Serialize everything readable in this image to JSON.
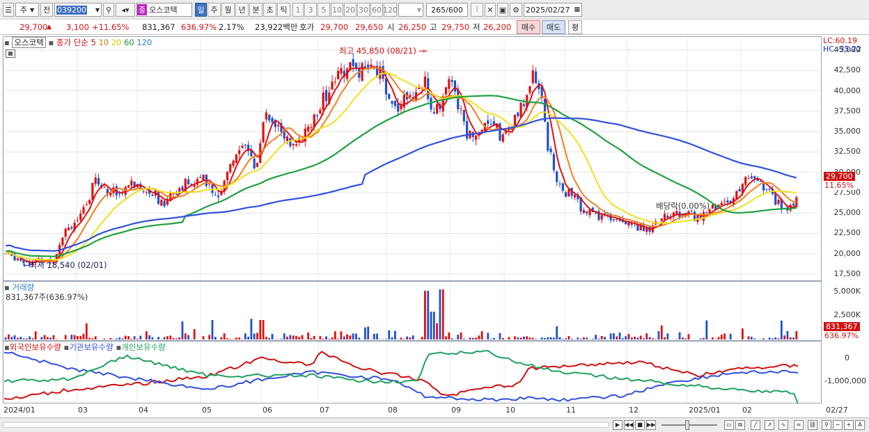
{
  "toolbar": {
    "period_select": "주",
    "prev_label": "전",
    "code": "039200",
    "stock_tag": "종",
    "stock_name": "오스코텍",
    "periods": [
      "일",
      "주",
      "월",
      "년",
      "분",
      "초",
      "틱"
    ],
    "intervals": [
      "1",
      "3",
      "5",
      "10",
      "20",
      "30",
      "60",
      "120"
    ],
    "count": "265",
    "count_total": "/600",
    "date": "2025/02/27"
  },
  "info": {
    "price": "29,700",
    "change": "3,100",
    "change_pct": "+11.65%",
    "volume": "831,367",
    "volume_ratio": "636.97%",
    "turnover_pct": "2.17%",
    "trade_amount": "23,922백만",
    "quote_label": "호가",
    "ask": "29,700",
    "bid": "29,650",
    "open_label": "시",
    "open": "26,250",
    "high_label": "고",
    "high": "29,750",
    "low_label": "저",
    "low": "26,200",
    "buy_label": "매수",
    "sell_label": "매도",
    "avg_label": "평"
  },
  "price_pane": {
    "name_box": "오스코텍",
    "legend_close": "종가 단순",
    "ma_periods": [
      "5",
      "10",
      "20",
      "60",
      "120"
    ],
    "ma_colors": [
      "#e01010",
      "#f08020",
      "#f0e020",
      "#20a040",
      "#3050e0"
    ],
    "lc": "LC:60.19",
    "hc": "HC:-35.22",
    "high_annot": "최고 45,850 (08/21)",
    "low_annot": "최저 18,540 (02/01)",
    "div_annot": "배당락(0.00%)",
    "price_tag": "29,700",
    "pct_tag": "11.65%",
    "yticks": [
      "45,000",
      "42,500",
      "40,000",
      "37,500",
      "35,000",
      "32,500",
      "30,000",
      "27,500",
      "25,000",
      "22,500",
      "20,000",
      "17,500"
    ]
  },
  "volume_pane": {
    "title": "거래량",
    "value": "831,367주(636.97%)",
    "yticks": [
      "5,000K",
      "2,500K"
    ],
    "tag": "831,367",
    "tag_pct": "636.97%"
  },
  "holder_pane": {
    "legend": [
      "외국인보유수량",
      "기관보유수량",
      "개인보유수량"
    ],
    "colors": [
      "#d01010",
      "#3050e0",
      "#20a060"
    ],
    "yticks": [
      "0",
      "-1,000,000"
    ]
  },
  "xaxis": [
    "2024/01",
    "03",
    "04",
    "05",
    "06",
    "07",
    "08",
    "09",
    "10",
    "11",
    "12",
    "2025/01",
    "02"
  ],
  "xaxis_end": "02/27",
  "chart_data": {
    "type": "candlestick",
    "x": [
      "2024/01",
      "03",
      "04",
      "05",
      "06",
      "07",
      "08",
      "09",
      "10",
      "11",
      "12",
      "2025/01",
      "02"
    ],
    "close_approx": [
      19500,
      27500,
      28000,
      28500,
      38000,
      40000,
      42000,
      37000,
      41000,
      26000,
      23500,
      25500,
      29700
    ],
    "ylim": [
      17500,
      45000
    ],
    "high": 45850,
    "low": 18540
  }
}
